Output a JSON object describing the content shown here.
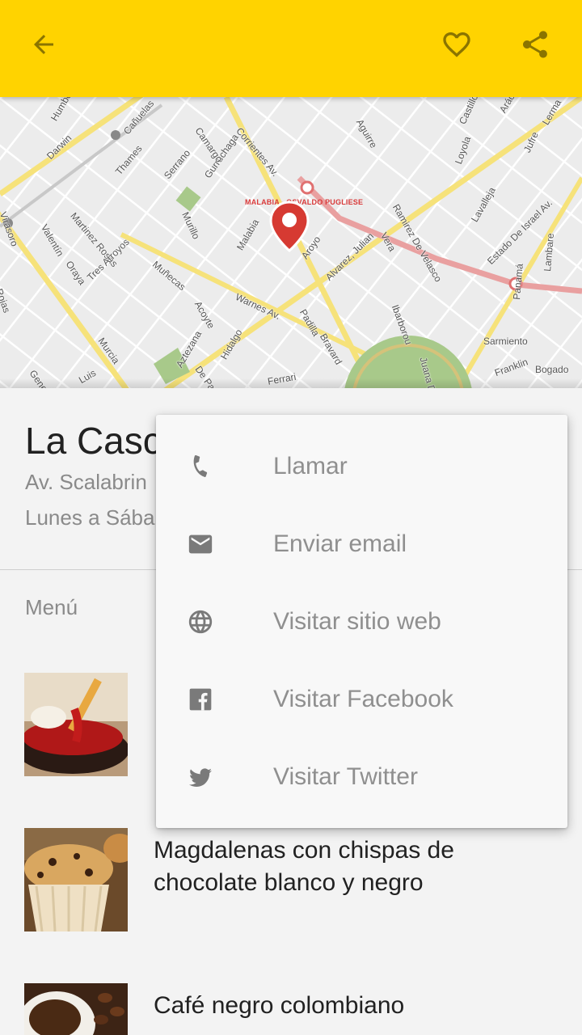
{
  "toolbar": {
    "back_icon": "arrow-back-icon",
    "favorite_icon": "heart-outline-icon",
    "share_icon": "share-icon",
    "color": "#ffd300",
    "icon_color": "#8a7400"
  },
  "map": {
    "streets": [
      "Humboldt",
      "Darwin",
      "Cañuelas",
      "Thames",
      "Serrano",
      "Gurruchaga",
      "Camargo",
      "Corrientes Av.",
      "Aguirre",
      "Castillo",
      "Aráoz",
      "Lerma",
      "Jufre",
      "Loyola",
      "Lavalleja",
      "Ramirez De Velasco",
      "Vera",
      "Estado De Israel Av.",
      "Lambare",
      "Virasoro",
      "Valentín",
      "Martinez Rosas",
      "Oraya",
      "Tres Arroyos",
      "Muñecas",
      "Murillo",
      "Malabia",
      "Warnes Av.",
      "Aroyo",
      "Acoyte",
      "Padilla",
      "Bravard",
      "Alvarez, Julian",
      "Ibarborou",
      "Juana De",
      "Panamá",
      "Sarmiento",
      "Bogado",
      "Franklin",
      "Murcia",
      "Hidalgo",
      "De Parque",
      "Aztezana",
      "Ferrari",
      "Rojas",
      "Luis",
      "General"
    ],
    "station_label": "MALABIA - OSVALDO PUGLIESE",
    "pin_color": "#d63a32"
  },
  "place": {
    "name": "La Casc",
    "address": "Av. Scalabrin",
    "hours": "Lunes a Sába"
  },
  "menu_section_label": "Menú",
  "menu_items": [
    {
      "name": "",
      "image": "fries-ketchup-photo"
    },
    {
      "name": "Magdalenas con chispas de chocolate blanco y negro",
      "image": "muffin-photo"
    },
    {
      "name": "Café negro colombiano",
      "image": "coffee-photo"
    }
  ],
  "contact_menu": {
    "items": [
      {
        "label": "Llamar",
        "icon": "phone-icon"
      },
      {
        "label": "Enviar email",
        "icon": "email-icon"
      },
      {
        "label": "Visitar sitio web",
        "icon": "globe-icon"
      },
      {
        "label": "Visitar Facebook",
        "icon": "facebook-icon"
      },
      {
        "label": "Visitar Twitter",
        "icon": "twitter-icon"
      }
    ]
  }
}
